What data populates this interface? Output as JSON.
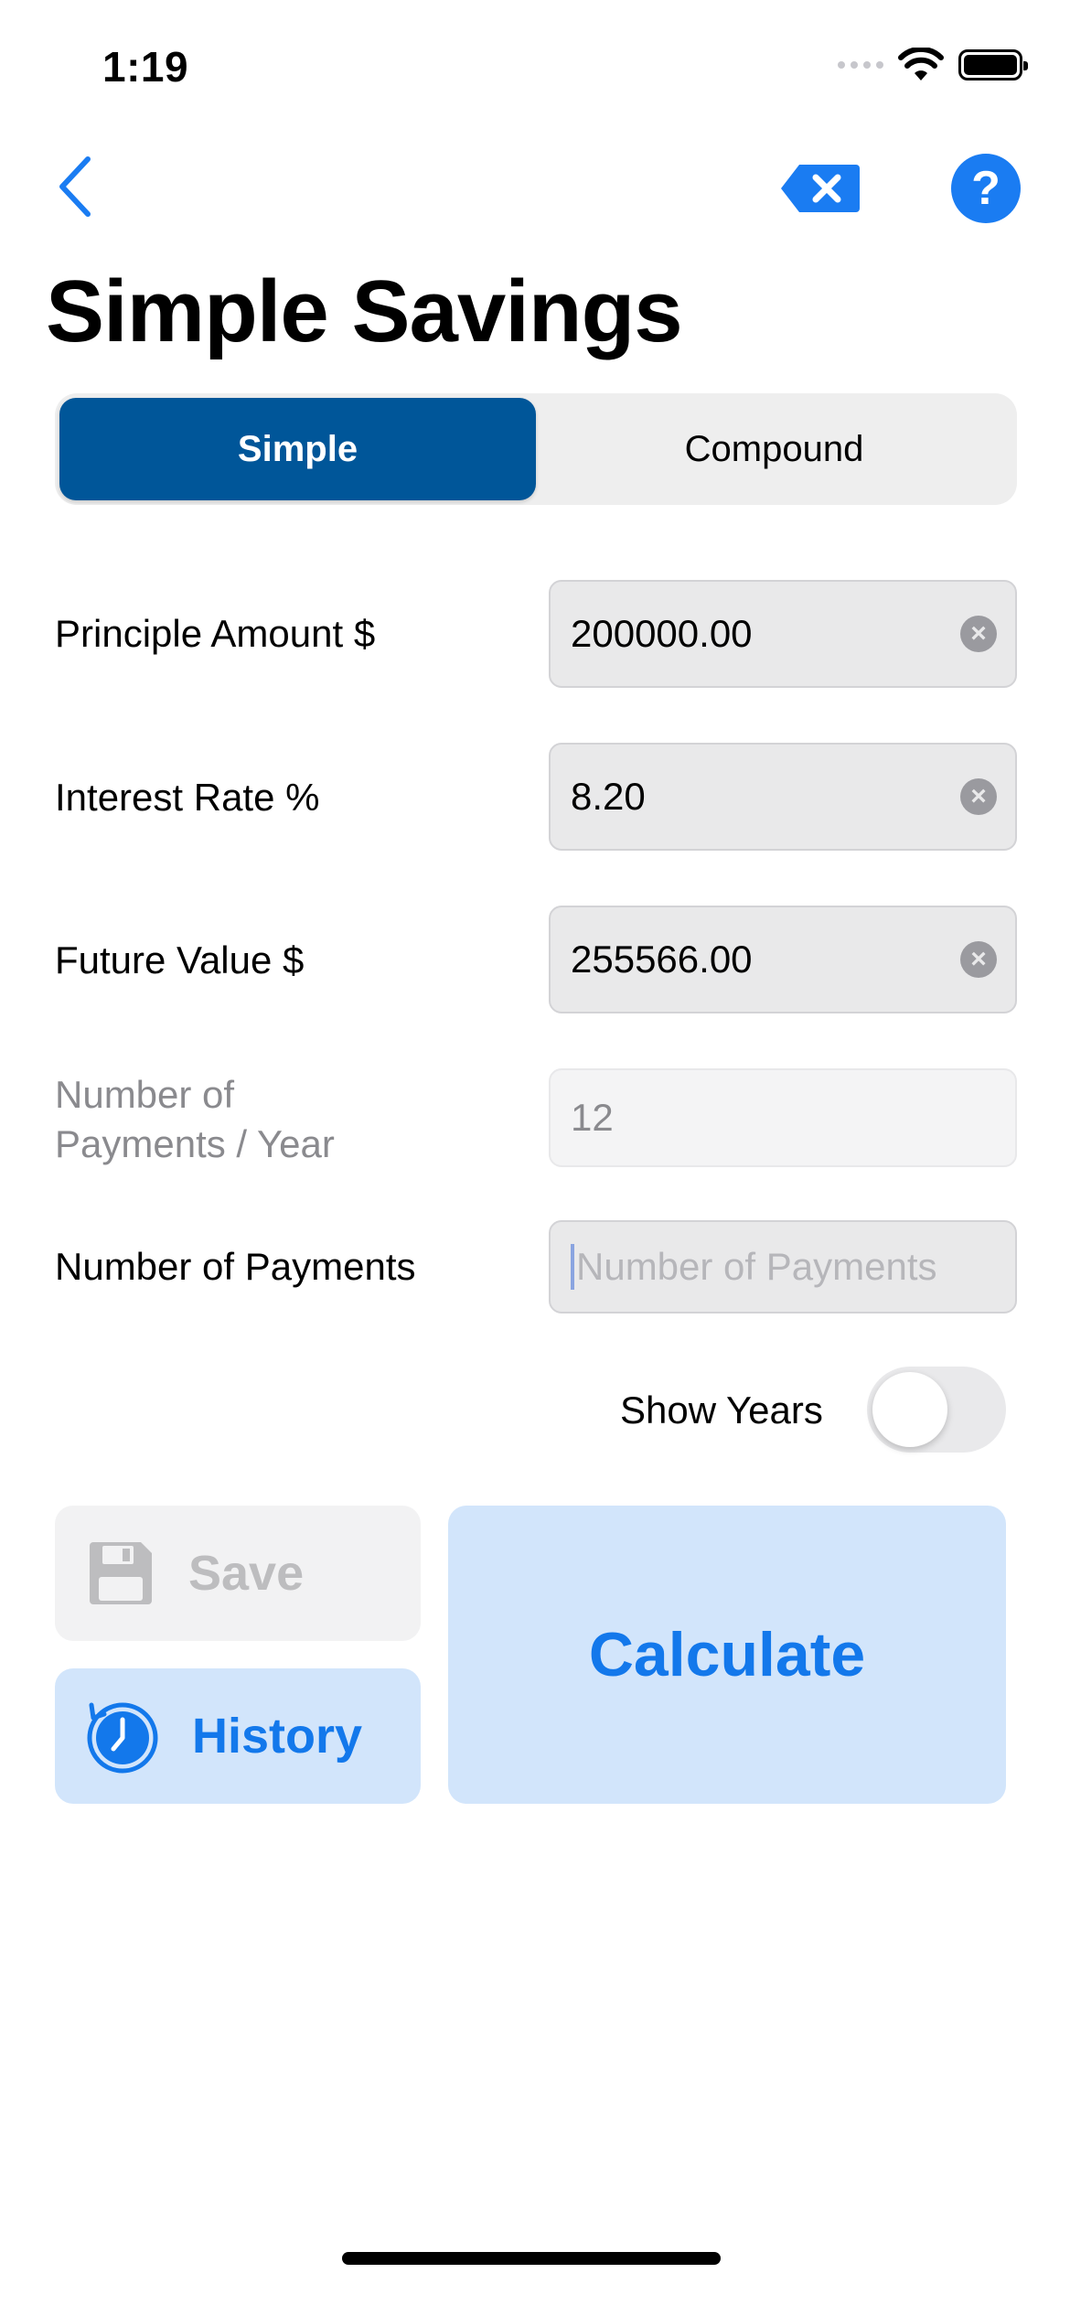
{
  "status_bar": {
    "time": "1:19"
  },
  "nav": {
    "back_icon": "chevron-left-icon",
    "clear_icon": "delete-left-icon",
    "help_label": "?"
  },
  "title": "Simple Savings",
  "segments": [
    {
      "label": "Simple",
      "selected": true
    },
    {
      "label": "Compound",
      "selected": false
    }
  ],
  "form": {
    "principal": {
      "label": "Principle Amount $",
      "value": "200000.00"
    },
    "interest": {
      "label": "Interest Rate %",
      "value": "8.20"
    },
    "future_value": {
      "label": "Future Value $",
      "value": "255566.00"
    },
    "payments_per_year": {
      "label_line1": "Number of",
      "label_line2": "Payments / Year",
      "value": "12"
    },
    "num_payments": {
      "label": "Number of Payments",
      "placeholder": "Number of Payments",
      "value": ""
    }
  },
  "toggle": {
    "label": "Show Years",
    "on": false
  },
  "buttons": {
    "save": "Save",
    "history": "History",
    "calculate": "Calculate"
  },
  "colors": {
    "accent": "#1378eb",
    "segment_active": "#005699",
    "button_bg": "#d2e5fb"
  }
}
